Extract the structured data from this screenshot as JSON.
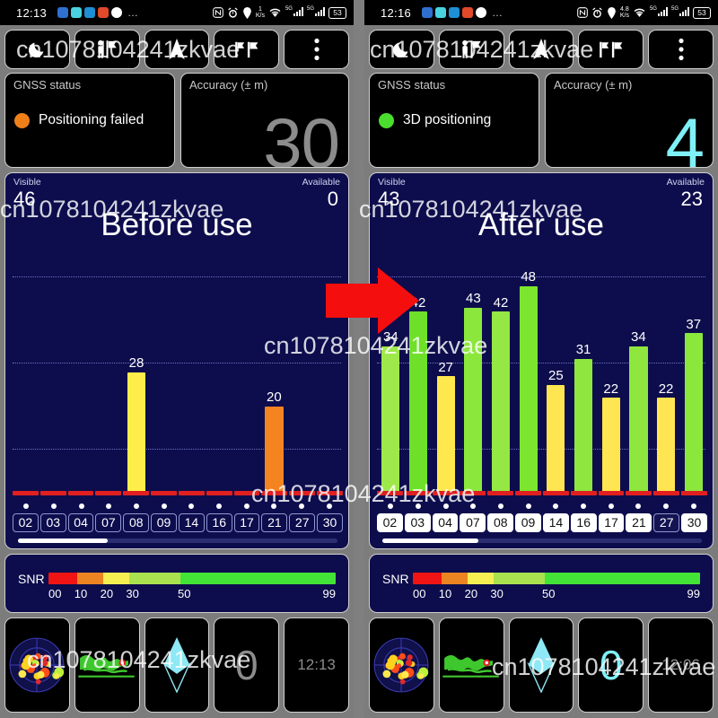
{
  "watermark": {
    "text": "cn1078104241zkvae"
  },
  "arrow": {
    "name": "right-arrow",
    "color": "#f40e0e"
  },
  "panels": [
    {
      "id": "before",
      "caption": "Before use",
      "statusbar": {
        "clock": "12:13",
        "netspeed_value": "1",
        "netspeed_unit": "K/s",
        "battery": "53",
        "overflow": "…",
        "icons": [
          "nfc-icon",
          "alarm-icon",
          "location-icon",
          "wifi-icon",
          "signal-5g-icon",
          "signal-5g-icon",
          "battery-icon"
        ]
      },
      "toolbar": [
        {
          "name": "night-mode-button",
          "icon": "moon-icon"
        },
        {
          "name": "pedestrian-button",
          "icon": "person-flag-icon"
        },
        {
          "name": "navigation-button",
          "icon": "navigation-arrow-icon"
        },
        {
          "name": "waypoints-button",
          "icon": "flags-icon"
        },
        {
          "name": "overflow-menu-button",
          "icon": "three-dots-vertical-icon"
        }
      ],
      "gnss": {
        "title": "GNSS status",
        "value": "Positioning failed",
        "dot_color": "#ef8019"
      },
      "accuracy": {
        "title": "Accuracy (± m)",
        "value": "30",
        "color": "#8c8c8c"
      },
      "chart_data": {
        "type": "bar",
        "title": "Before use",
        "visible_label": "Visible",
        "visible_count": "46",
        "available_label": "Available",
        "available_count": "0",
        "xlabel": "",
        "ylabel": "SNR",
        "ylim": [
          0,
          55
        ],
        "grid": true,
        "gridlines": [
          50,
          30,
          10
        ],
        "categories": [
          "02",
          "03",
          "04",
          "07",
          "08",
          "09",
          "14",
          "16",
          "17",
          "21",
          "27",
          "30"
        ],
        "values": [
          0,
          0,
          0,
          0,
          28,
          0,
          0,
          0,
          0,
          20,
          0,
          0
        ],
        "bar_colors": [
          "",
          "",
          "",
          "",
          "#ffee4a",
          "",
          "",
          "",
          "",
          "#f48420",
          "",
          ""
        ],
        "chip_states": [
          "hollow",
          "hollow",
          "hollow",
          "hollow",
          "hollow",
          "hollow",
          "hollow",
          "hollow",
          "hollow",
          "hollow",
          "hollow",
          "hollow"
        ],
        "scroll_fraction": 0.28
      },
      "snr": {
        "label": "SNR",
        "ticks": [
          "00",
          "10",
          "20",
          "30",
          "50",
          "99"
        ],
        "tick_positions": [
          0,
          9,
          18,
          27,
          45,
          100
        ],
        "segments": [
          {
            "color": "#f01414",
            "width": 10
          },
          {
            "color": "#ec8422",
            "width": 9
          },
          {
            "color": "#f6ef52",
            "width": 9
          },
          {
            "color": "#aae24f",
            "width": 18
          },
          {
            "color": "#44e337",
            "width": 54
          }
        ]
      },
      "bottom": [
        {
          "name": "sky-plot-tile",
          "icon": "sky-plot-icon"
        },
        {
          "name": "world-map-tile",
          "icon": "world-map-icon"
        },
        {
          "name": "compass-tile",
          "icon": "compass-needle-icon"
        },
        {
          "name": "speed-tile",
          "value": "0",
          "color": "#8c8c8c"
        },
        {
          "name": "clock-tile",
          "value": "12:13",
          "color": "#8c8c8c"
        }
      ]
    },
    {
      "id": "after",
      "caption": "After use",
      "statusbar": {
        "clock": "12:16",
        "netspeed_value": "4.8",
        "netspeed_unit": "K/s",
        "battery": "53",
        "overflow": "…",
        "icons": [
          "nfc-icon",
          "alarm-icon",
          "location-icon",
          "wifi-icon",
          "signal-5g-icon",
          "signal-5g-icon",
          "battery-icon"
        ]
      },
      "toolbar": [
        {
          "name": "night-mode-button",
          "icon": "moon-icon"
        },
        {
          "name": "pedestrian-button",
          "icon": "person-flag-icon"
        },
        {
          "name": "navigation-button",
          "icon": "navigation-arrow-icon"
        },
        {
          "name": "waypoints-button",
          "icon": "flags-icon"
        },
        {
          "name": "overflow-menu-button",
          "icon": "three-dots-vertical-icon"
        }
      ],
      "gnss": {
        "title": "GNSS status",
        "value": "3D positioning",
        "dot_color": "#4ade2e"
      },
      "accuracy": {
        "title": "Accuracy (± m)",
        "value": "4",
        "color": "#7ff0f7"
      },
      "chart_data": {
        "type": "bar",
        "title": "After use",
        "visible_label": "Visible",
        "visible_count": "43",
        "available_label": "Available",
        "available_count": "23",
        "xlabel": "",
        "ylabel": "SNR",
        "ylim": [
          0,
          55
        ],
        "grid": true,
        "gridlines": [
          50,
          30,
          10
        ],
        "categories": [
          "02",
          "03",
          "04",
          "07",
          "08",
          "09",
          "14",
          "16",
          "17",
          "21",
          "27",
          "30"
        ],
        "values": [
          34,
          42,
          27,
          43,
          42,
          48,
          25,
          31,
          22,
          34,
          22,
          37
        ],
        "bar_colors": [
          "#9ee84b",
          "#6fe02a",
          "#ffe84d",
          "#8ce73c",
          "#95e744",
          "#7ce52f",
          "#ffe551",
          "#8ee63f",
          "#ffe551",
          "#8ee63f",
          "#ffe551",
          "#8ce73c"
        ],
        "chip_states": [
          "filled",
          "filled",
          "filled",
          "filled",
          "filled",
          "filled",
          "filled",
          "filled",
          "filled",
          "filled",
          "inverted",
          "filled"
        ],
        "scroll_fraction": 0.3
      },
      "snr": {
        "label": "SNR",
        "ticks": [
          "00",
          "10",
          "20",
          "30",
          "50",
          "99"
        ],
        "tick_positions": [
          0,
          9,
          18,
          27,
          45,
          100
        ],
        "segments": [
          {
            "color": "#f01414",
            "width": 10
          },
          {
            "color": "#ec8422",
            "width": 9
          },
          {
            "color": "#f6ef52",
            "width": 9
          },
          {
            "color": "#aae24f",
            "width": 18
          },
          {
            "color": "#44e337",
            "width": 54
          }
        ]
      },
      "bottom": [
        {
          "name": "sky-plot-tile",
          "icon": "sky-plot-icon"
        },
        {
          "name": "world-map-tile",
          "icon": "world-map-icon"
        },
        {
          "name": "compass-tile",
          "icon": "compass-needle-icon"
        },
        {
          "name": "speed-tile",
          "value": "0",
          "color": "#7ff0f7"
        },
        {
          "name": "clock-tile",
          "value": "12:06",
          "color": "#8c8c8c"
        }
      ]
    }
  ]
}
